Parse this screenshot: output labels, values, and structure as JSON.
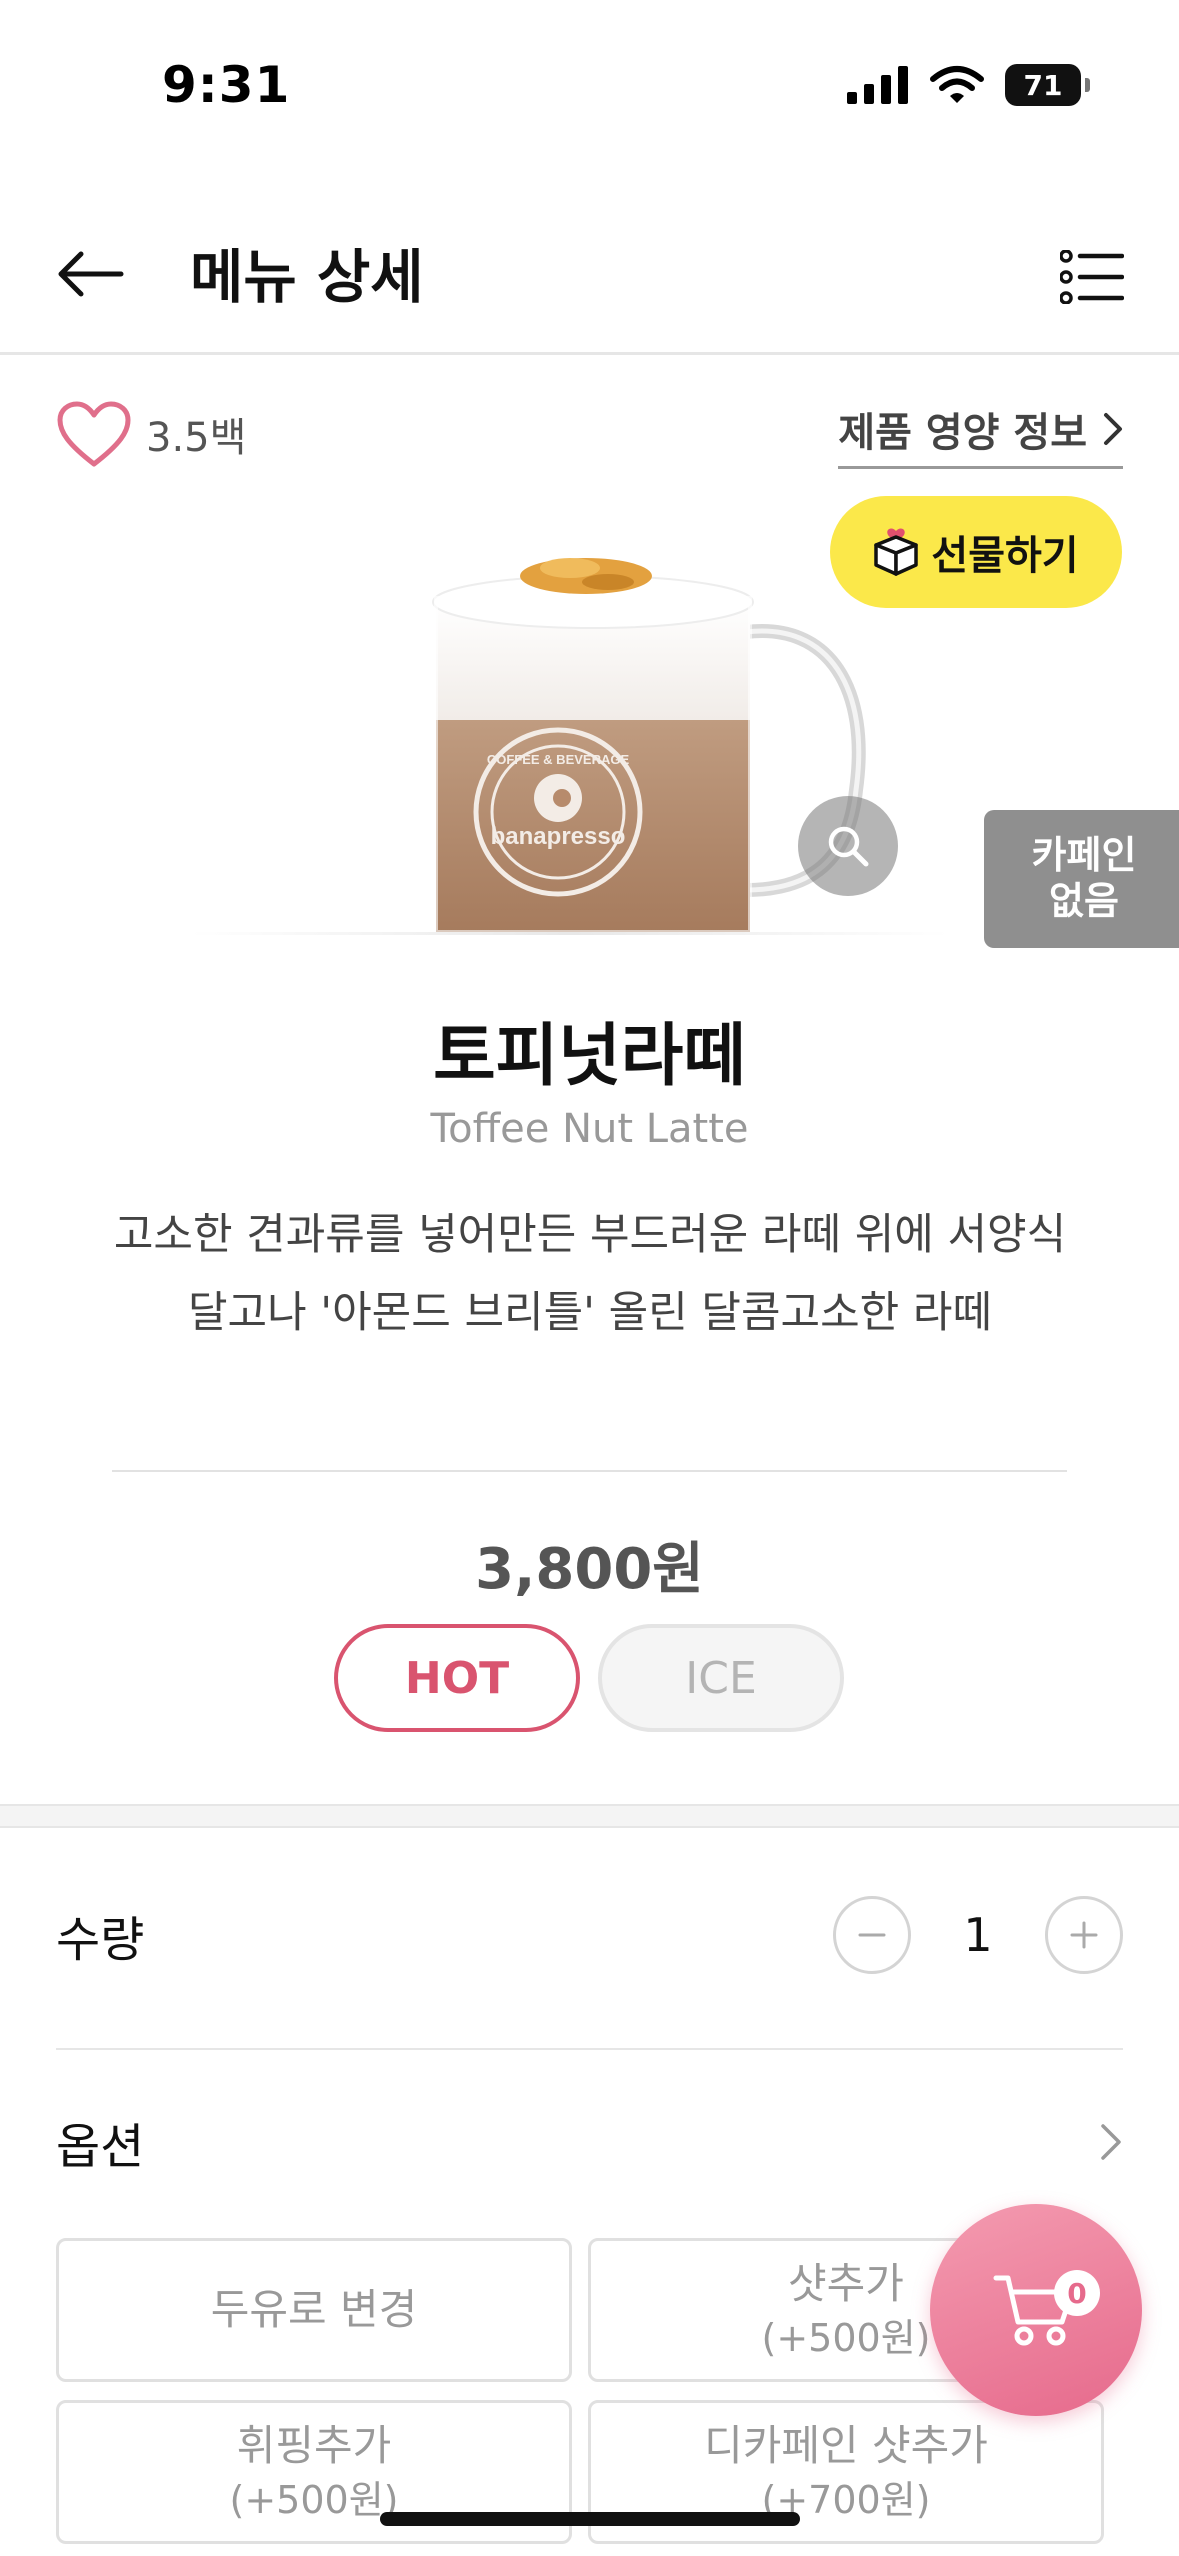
{
  "status_bar": {
    "time": "9:31",
    "battery": "71"
  },
  "header": {
    "title": "메뉴 상세",
    "back_icon": "arrow-left-icon",
    "menu_icon": "list-icon"
  },
  "product": {
    "like_count": "3.5백",
    "nutrition_link": "제품 영양 정보",
    "gift_label": "선물하기",
    "decaf_line1": "카페인",
    "decaf_line2": "없음",
    "image_logo_top": "COFFEE & BEVERAGE",
    "image_logo_bottom": "banapresso",
    "name_ko": "토피넛라떼",
    "name_en": "Toffee Nut Latte",
    "description": "고소한 견과류를 넣어만든 부드러운 라떼 위에 서양식 달고나 '아몬드 브리틀' 올린 달콤고소한 라떼",
    "price": "3,800원",
    "temperature_options": [
      "HOT",
      "ICE"
    ],
    "selected_temperature": "HOT"
  },
  "quantity": {
    "label": "수량",
    "value": "1"
  },
  "options": {
    "label": "옵션",
    "items": [
      {
        "name": "두유로 변경",
        "price": ""
      },
      {
        "name": "샷추가",
        "price": "(+500원)"
      },
      {
        "name": "휘핑추가",
        "price": "(+500원)"
      },
      {
        "name": "디카페인 샷추가",
        "price": "(+700원)"
      }
    ]
  },
  "cart": {
    "count": "0"
  },
  "colors": {
    "accent": "#d9546f",
    "gift_button": "#fbe84a",
    "cart_fab": "#e66a8c",
    "decaf_badge": "#8f8f8f"
  }
}
